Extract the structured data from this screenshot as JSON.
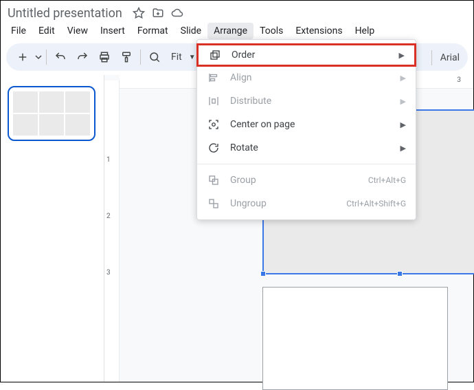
{
  "titlebar": {
    "doc_title": "Untitled presentation"
  },
  "menubar": {
    "items": [
      {
        "label": "File"
      },
      {
        "label": "Edit"
      },
      {
        "label": "View"
      },
      {
        "label": "Insert"
      },
      {
        "label": "Format"
      },
      {
        "label": "Slide"
      },
      {
        "label": "Arrange"
      },
      {
        "label": "Tools"
      },
      {
        "label": "Extensions"
      },
      {
        "label": "Help"
      }
    ],
    "active_index": 6
  },
  "toolbar": {
    "zoom_label": "Fit",
    "font_name": "Arial"
  },
  "ruler": {
    "v_ticks": [
      "1",
      "2",
      "3"
    ],
    "h_tick": "3"
  },
  "dropdown": {
    "items": [
      {
        "label": "Order",
        "icon": "layers",
        "disabled": false,
        "submenu": true,
        "highlighted": true
      },
      {
        "label": "Align",
        "icon": "align-left",
        "disabled": true,
        "submenu": true
      },
      {
        "label": "Distribute",
        "icon": "distribute",
        "disabled": true,
        "submenu": true
      },
      {
        "label": "Center on page",
        "icon": "center-focus",
        "disabled": false,
        "submenu": true
      },
      {
        "label": "Rotate",
        "icon": "rotate",
        "disabled": false,
        "submenu": true
      },
      {
        "sep": true
      },
      {
        "label": "Group",
        "icon": "group",
        "disabled": true,
        "shortcut": "Ctrl+Alt+G"
      },
      {
        "label": "Ungroup",
        "icon": "ungroup",
        "disabled": true,
        "shortcut": "Ctrl+Alt+Shift+G"
      }
    ]
  }
}
